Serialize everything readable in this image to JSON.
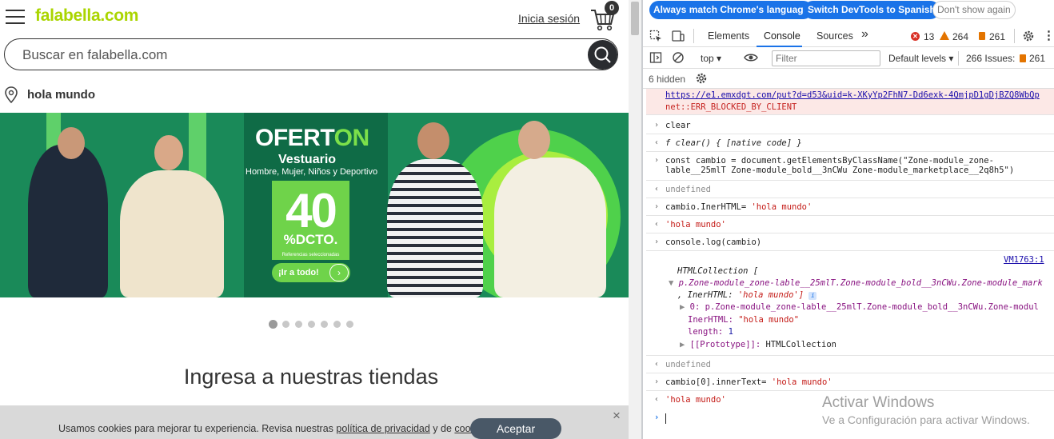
{
  "site": {
    "logo_name": "falabella",
    "logo_suffix": ".com",
    "login_link": "Inicia sesión",
    "cart_count": "0",
    "search_placeholder": "Buscar en falabella.com",
    "location_text": "hola mundo",
    "banner": {
      "title_main": "OFERT",
      "title_accent": "ON",
      "subtitle": "Vestuario",
      "subtitle2": "Hombre, Mujer, Niños y Deportivo",
      "percent": "40",
      "percent_label": "%DCTO.",
      "note": "Referencias seleccionadas",
      "cta": "¡Ir a todo!"
    },
    "carousel_dots": 7,
    "carousel_active": 0,
    "section_heading": "Ingresa a nuestras tiendas",
    "cookie": {
      "text_1": "Usamos cookies para mejorar tu experiencia. Revisa nuestras ",
      "link_privacy": "política de privacidad",
      "text_2": " y de ",
      "link_cookies": "cookies",
      "text_3": ".",
      "accept": "Aceptar",
      "close": "×"
    },
    "colors": {
      "brand": "#aad500",
      "banner_bg": "#1a8a59",
      "accept_btn": "#495867"
    }
  },
  "devtools": {
    "lang_bar": {
      "match_language": "Always match Chrome's language",
      "switch_language": "Switch DevTools to Spanish",
      "dont_show": "Don't show again"
    },
    "tabs": [
      "Elements",
      "Console",
      "Sources"
    ],
    "active_tab": "Console",
    "more_tabs": "»",
    "counts": {
      "errors": "13",
      "warnings": "264",
      "issues": "261"
    },
    "context": "top",
    "filter_placeholder": "Filter",
    "levels": "Default levels",
    "issues_label": "266 Issues:",
    "issues_count": "261",
    "hidden": "6 hidden",
    "console": {
      "error_url": "https://e1.emxdgt.com/put?d=d53&uid=k-XKyYp2FhN7-Dd6exk-4QmjpD1gDjBZQ8WbQp",
      "error_msg": "net::ERR_BLOCKED_BY_CLIENT",
      "in_1": "clear",
      "out_1": "f clear() { [native code] }",
      "in_2a": "const cambio = document.getElementsByClassName(\"Zone-module_zone-",
      "in_2b": "lable__25mlT Zone-module_bold__3nCWu Zone-module_marketplace__2q8h5\")",
      "out_2": "undefined",
      "in_3_code": "cambio.InerHTML= ",
      "in_3_str": "'hola mundo'",
      "out_3": "'hola mundo'",
      "in_4": "console.log(cambio)",
      "source_link": "VM1763:1",
      "log_1": "HTMLCollection [",
      "log_2": "p.Zone-module_zone-lable__25mlT.Zone-module_bold__3nCWu.Zone-module_mark",
      "log_3_a": ", InerHTML: ",
      "log_3_b": "'hola mundo']",
      "log_4_key": "0: ",
      "log_4_val": "p.Zone-module_zone-lable__25mlT.Zone-module_bold__3nCWu.Zone-modul",
      "log_5_key": "InerHTML: ",
      "log_5_val": "\"hola mundo\"",
      "log_6_key": "length: ",
      "log_6_val": "1",
      "log_7_key": "[[Prototype]]: ",
      "log_7_val": "HTMLCollection",
      "out_4": "undefined",
      "in_5_code": "cambio[0].innerText= ",
      "in_5_str": "'hola mundo'",
      "out_5": "'hola mundo'"
    },
    "colors": {
      "accent": "#1a73e8",
      "error": "#d93025",
      "warning": "#e37400"
    }
  },
  "watermark": {
    "line1": "Activar Windows",
    "line2": "Ve a Configuración para activar Windows."
  }
}
